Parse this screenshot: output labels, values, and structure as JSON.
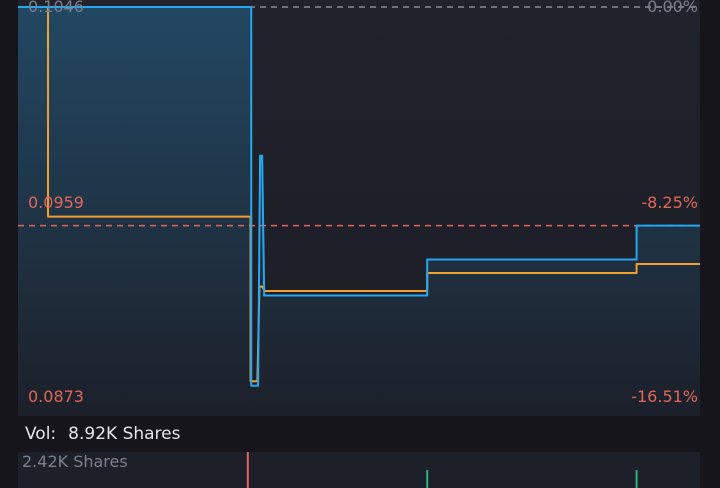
{
  "chart_data": {
    "type": "line",
    "y_axis_left": {
      "ticks": [
        "0.1046",
        "0.0959",
        "0.0873"
      ],
      "ylim": [
        0.0873,
        0.1046
      ]
    },
    "y_axis_right": {
      "ticks": [
        "0.00%",
        "-8.25%",
        "-16.51%"
      ]
    },
    "reference_lines": [
      {
        "value": 0.1046,
        "style": "dashed",
        "color": "#8a8d99"
      },
      {
        "value": 0.0949,
        "style": "dashed",
        "color": "#e0665a"
      }
    ],
    "series": [
      {
        "color": "#26a8f0",
        "fill": true,
        "points": [
          [
            0,
            0.1046
          ],
          [
            342,
            0.1046
          ],
          [
            342,
            0.0878
          ],
          [
            352,
            0.0878
          ],
          [
            355,
            0.098
          ],
          [
            358,
            0.098
          ],
          [
            361,
            0.0918
          ],
          [
            600,
            0.0918
          ],
          [
            600,
            0.0934
          ],
          [
            907,
            0.0934
          ],
          [
            907,
            0.0949
          ],
          [
            1000,
            0.0949
          ]
        ]
      },
      {
        "color": "#f0a030",
        "fill": false,
        "points": [
          [
            0,
            0.1046
          ],
          [
            44,
            0.1046
          ],
          [
            44,
            0.0953
          ],
          [
            341,
            0.0953
          ],
          [
            341,
            0.088
          ],
          [
            351,
            0.088
          ],
          [
            354,
            0.0922
          ],
          [
            358,
            0.0922
          ],
          [
            362,
            0.092
          ],
          [
            600,
            0.092
          ],
          [
            600,
            0.0928
          ],
          [
            907,
            0.0928
          ],
          [
            907,
            0.0932
          ],
          [
            1000,
            0.0932
          ]
        ]
      }
    ],
    "volume": {
      "title": "Vol:",
      "total": "8.92K Shares",
      "max_label": "2.42K Shares",
      "bars": [
        {
          "x": 337,
          "value": 2.42,
          "color": "#e0665a"
        },
        {
          "x": 600,
          "value": 1.2,
          "color": "#2fb37a"
        },
        {
          "x": 907,
          "value": 1.2,
          "color": "#2fb37a"
        }
      ],
      "vmax": 2.42
    }
  },
  "colors": {
    "up": "#2fb37a",
    "down": "#e0665a",
    "neutral": "#8a8d99"
  }
}
